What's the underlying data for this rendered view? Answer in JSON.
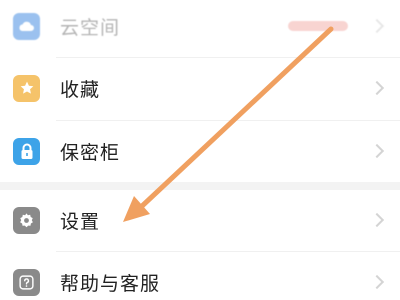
{
  "menu": {
    "items": [
      {
        "label": "云空间",
        "icon": "cloud-icon"
      },
      {
        "label": "收藏",
        "icon": "star-icon"
      },
      {
        "label": "保密柜",
        "icon": "lock-icon"
      },
      {
        "label": "设置",
        "icon": "gear-icon"
      },
      {
        "label": "帮助与客服",
        "icon": "help-icon"
      }
    ]
  },
  "annotation": {
    "type": "arrow",
    "color": "#f0a060",
    "points_to": "设置"
  },
  "colors": {
    "cloud_icon_bg": "#4a90e2",
    "star_icon_bg": "#f5c36a",
    "lock_icon_bg": "#3da3e8",
    "gear_icon_bg": "#8a8a8a",
    "help_icon_bg": "#8a8a8a",
    "arrow": "#f0a060"
  }
}
